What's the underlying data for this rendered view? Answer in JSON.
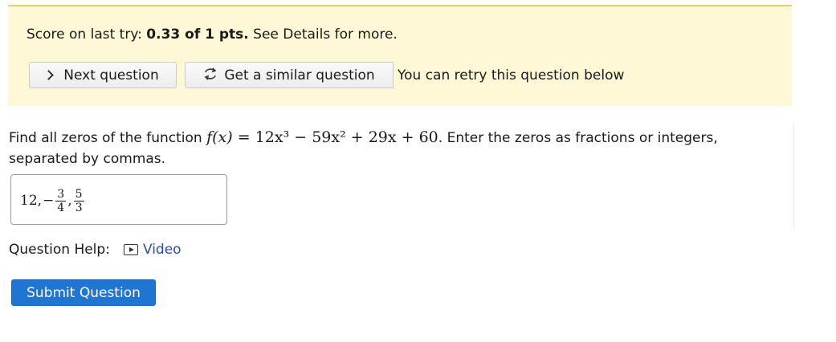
{
  "score": {
    "prefix": "Score on last try: ",
    "value": "0.33 of 1 pts.",
    "suffix": " See Details for more."
  },
  "buttons": {
    "next_label": "Next question",
    "similar_label": "Get a similar question",
    "retry_text": "You can retry this question below"
  },
  "question": {
    "prefix": "Find all zeros of the function ",
    "function_lhs": "f(x) = ",
    "function_rhs": "12x³ − 59x² + 29x + 60",
    "suffix": ". Enter the zeros as fractions or integers, separated by commas."
  },
  "answer": {
    "first": "12,",
    "minus": "−",
    "frac1": {
      "num": "3",
      "den": "4"
    },
    "comma": ",",
    "frac2": {
      "num": "5",
      "den": "3"
    }
  },
  "help": {
    "label": "Question Help:",
    "video_label": "Video"
  },
  "submit_label": "Submit Question",
  "colors": {
    "banner_bg": "#fff8d6",
    "banner_border": "#f3c86b",
    "submit_bg": "#1f76d2",
    "link": "#2a4db0"
  },
  "icons": [
    "chevron-right-icon",
    "retry-arrows-icon",
    "video-play-icon"
  ]
}
